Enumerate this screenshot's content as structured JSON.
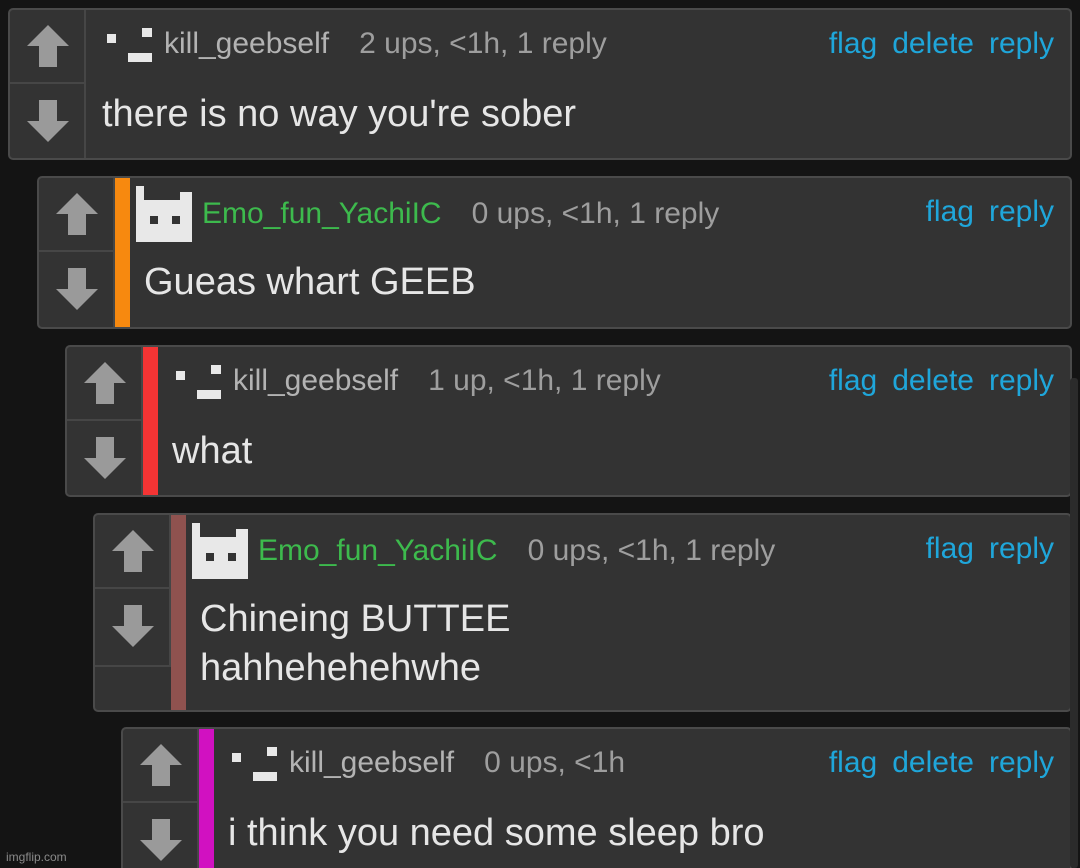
{
  "comments": [
    {
      "username": "kill_geebself",
      "meta": "2 ups, <1h, 1 reply",
      "text": "there is no way you're sober",
      "actions": [
        "flag",
        "delete",
        "reply"
      ]
    },
    {
      "username": "Emo_fun_YachiIC",
      "meta": "0 ups, <1h, 1 reply",
      "text": "Gueas whart GEEB",
      "actions": [
        "flag",
        "reply"
      ],
      "stripe_color": "#f7890f"
    },
    {
      "username": "kill_geebself",
      "meta": "1 up, <1h, 1 reply",
      "text": "what",
      "actions": [
        "flag",
        "delete",
        "reply"
      ],
      "stripe_color": "#f43434"
    },
    {
      "username": "Emo_fun_YachiIC",
      "meta": "0 ups, <1h, 1 reply",
      "text": "Chineing BUTTEE\nhahhehehehwhe",
      "actions": [
        "flag",
        "reply"
      ],
      "stripe_color": "#8f524f"
    },
    {
      "username": "kill_geebself",
      "meta": "0 ups, <1h",
      "text": "i think you need some sleep bro",
      "actions": [
        "flag",
        "delete",
        "reply"
      ],
      "stripe_color": "#d111c1"
    }
  ],
  "watermark": "imgflip.com",
  "colors": {
    "link": "#1fa6da",
    "username_green": "#3dba4d",
    "panel": "#333333"
  }
}
